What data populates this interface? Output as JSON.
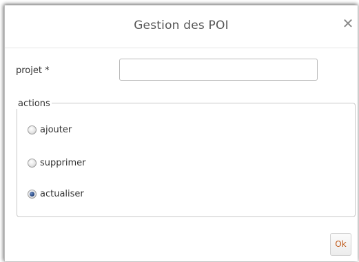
{
  "dialog": {
    "title": "Gestion des POI",
    "close_glyph": "✕",
    "close_icon": "close-icon"
  },
  "form": {
    "projet_label": "projet *",
    "projet_value": "",
    "projet_placeholder": ""
  },
  "actions": {
    "legend": "actions",
    "options": [
      {
        "label": "ajouter",
        "checked": false
      },
      {
        "label": "supprimer",
        "checked": false
      },
      {
        "label": "actualiser",
        "checked": true
      }
    ]
  },
  "footer": {
    "ok_label": "Ok"
  },
  "colors": {
    "ok_text": "#c05a1a",
    "radio_selected": "#1f3f7a"
  }
}
